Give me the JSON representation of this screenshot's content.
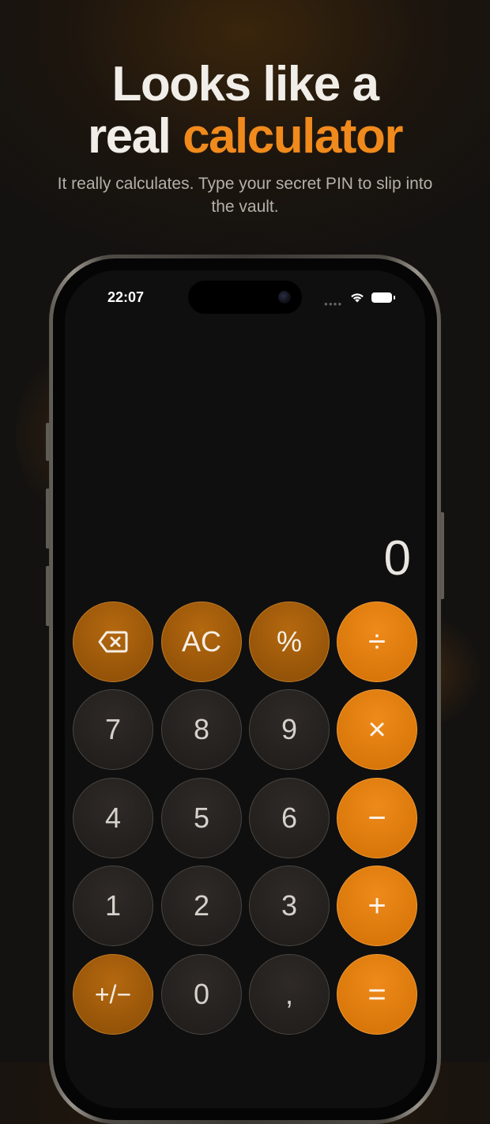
{
  "hero": {
    "headline_line1": "Looks like a",
    "headline_plain": "real ",
    "headline_accent": "calculator",
    "subtitle": "It really calculates. Type your secret PIN to slip into the vault."
  },
  "status_bar": {
    "time": "22:07"
  },
  "calculator": {
    "display_value": "0",
    "keys": {
      "backspace": "⌫",
      "ac": "AC",
      "percent": "%",
      "divide": "÷",
      "seven": "7",
      "eight": "8",
      "nine": "9",
      "multiply": "×",
      "four": "4",
      "five": "5",
      "six": "6",
      "minus": "−",
      "one": "1",
      "two": "2",
      "three": "3",
      "plus": "+",
      "plus_minus": "+/−",
      "zero": "0",
      "decimal": ",",
      "equals": "="
    }
  },
  "colors": {
    "accent": "#f08a1c",
    "function_key": "#a55e0c",
    "number_key": "#27231f",
    "background": "#141210"
  }
}
